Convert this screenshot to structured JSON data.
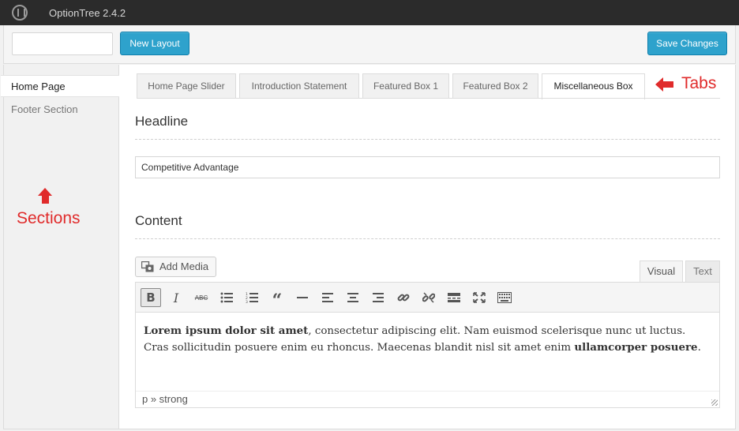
{
  "app": {
    "title": "OptionTree 2.4.2"
  },
  "header": {
    "layout_input_value": "",
    "new_layout_label": "New Layout",
    "save_label": "Save Changes"
  },
  "sidebar": {
    "items": [
      {
        "label": "Home Page",
        "active": true
      },
      {
        "label": "Footer Section",
        "active": false
      }
    ]
  },
  "annotations": {
    "sections": "Sections",
    "tabs": "Tabs"
  },
  "tabs": [
    {
      "label": "Home Page Slider",
      "active": false
    },
    {
      "label": "Introduction Statement",
      "active": false
    },
    {
      "label": "Featured Box 1",
      "active": false
    },
    {
      "label": "Featured Box 2",
      "active": false
    },
    {
      "label": "Miscellaneous Box",
      "active": true
    }
  ],
  "fields": {
    "headline_label": "Headline",
    "headline_value": "Competitive Advantage",
    "content_label": "Content"
  },
  "editor": {
    "add_media": "Add Media",
    "tab_visual": "Visual",
    "tab_text": "Text",
    "toolbar_icons": [
      "bold-icon",
      "italic-icon",
      "strikethrough-icon",
      "bullet-list-icon",
      "numbered-list-icon",
      "blockquote-icon",
      "horizontal-rule-icon",
      "align-left-icon",
      "align-center-icon",
      "align-right-icon",
      "link-icon",
      "unlink-icon",
      "read-more-icon",
      "fullscreen-icon",
      "toolbar-toggle-icon"
    ],
    "body": {
      "bold1": "Lorem ipsum dolor sit amet",
      "text1": ", consectetur adipiscing elit. Nam euismod scelerisque nunc ut luctus. Cras sollicitudin posuere enim eu rhoncus. Maecenas blandit nisl sit amet enim ",
      "bold2": "ullamcorper posuere",
      "text2": "."
    },
    "status_path": "p » strong"
  }
}
